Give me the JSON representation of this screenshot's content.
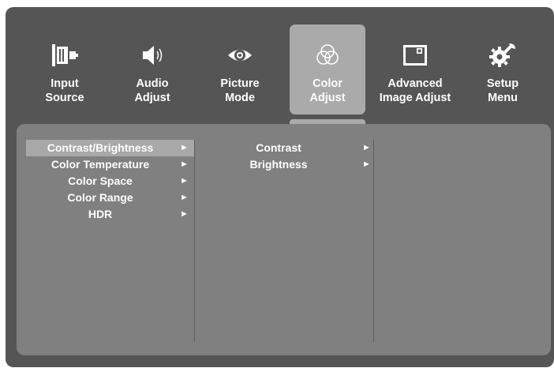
{
  "tabs": [
    {
      "label": "Input\nSource",
      "icon": "input-source-icon"
    },
    {
      "label": "Audio\nAdjust",
      "icon": "speaker-icon"
    },
    {
      "label": "Picture\nMode",
      "icon": "eye-icon"
    },
    {
      "label": "Color\nAdjust",
      "icon": "color-circles-icon",
      "active": true
    },
    {
      "label": "Advanced\nImage Adjust",
      "icon": "image-adjust-icon"
    },
    {
      "label": "Setup\nMenu",
      "icon": "gear-wrench-icon"
    }
  ],
  "menu": {
    "items": [
      {
        "label": "Contrast/Brightness",
        "arrow": "►",
        "selected": true
      },
      {
        "label": "Color Temperature",
        "arrow": "►"
      },
      {
        "label": "Color Space",
        "arrow": "►"
      },
      {
        "label": "Color Range",
        "arrow": "►"
      },
      {
        "label": "HDR",
        "arrow": "►"
      }
    ]
  },
  "submenu": {
    "items": [
      {
        "label": "Contrast",
        "arrow": "►"
      },
      {
        "label": "Brightness",
        "arrow": "►"
      }
    ]
  },
  "colors": {
    "background": "#555555",
    "panel": "#808080",
    "active_tab": "#aaaaaa",
    "selected_row": "#a8a8a8",
    "text": "#ffffff"
  }
}
